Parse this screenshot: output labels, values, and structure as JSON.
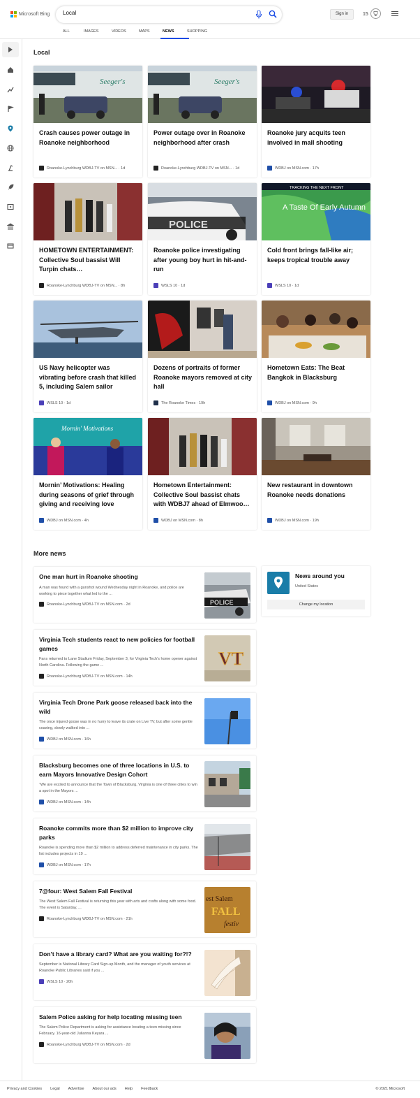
{
  "header": {
    "logo_text": "Microsoft Bing",
    "search_value": "Local",
    "signin_label": "Sign in",
    "points": "15",
    "tabs": [
      "ALL",
      "IMAGES",
      "VIDEOS",
      "MAPS",
      "NEWS",
      "SHOPPING"
    ],
    "active_tab": "NEWS"
  },
  "local": {
    "title": "Local",
    "cards": [
      {
        "title": "Crash causes power outage in Roanoke neighborhood",
        "source": "Roanoke-Lynchburg WDBJ-TV on MSN...",
        "age": "1d"
      },
      {
        "title": "Power outage over in Roanoke neighborhood after crash",
        "source": "Roanoke-Lynchburg WDBJ-TV on MSN...",
        "age": "1d"
      },
      {
        "title": "Roanoke jury acquits teen involved in mall shooting",
        "source": "WDBJ on MSN.com",
        "age": "17h"
      },
      {
        "title": "HOMETOWN ENTERTAINMENT: Collective Soul bassist Will Turpin chats…",
        "source": "Roanoke-Lynchburg WDBJ-TV on MSN...",
        "age": "8h"
      },
      {
        "title": "Roanoke police investigating after young boy hurt in hit-and-run",
        "source": "WSLS 10",
        "age": "1d"
      },
      {
        "title": "Cold front brings fall-like air; keeps tropical trouble away",
        "source": "WSLS 10",
        "age": "1d"
      },
      {
        "title": "US Navy helicopter was vibrating before crash that killed 5, including Salem sailor",
        "source": "WSLS 10",
        "age": "1d"
      },
      {
        "title": "Dozens of portraits of former Roanoke mayors removed at city hall",
        "source": "The Roanoke Times",
        "age": "19h"
      },
      {
        "title": "Hometown Eats: The Beat Bangkok in Blacksburg",
        "source": "WDBJ on MSN.com",
        "age": "9h"
      },
      {
        "title": "Mornin’ Motivations: Healing during seasons of grief through giving and receiving love",
        "source": "WDBJ on MSN.com",
        "age": "4h"
      },
      {
        "title": "Hometown Entertainment: Collective Soul bassist chats with WDBJ7 ahead of Elmwoo…",
        "source": "WDBJ on MSN.com",
        "age": "8h"
      },
      {
        "title": "New restaurant in downtown Roanoke needs donations",
        "source": "WDBJ on MSN.com",
        "age": "19h"
      }
    ],
    "image_texts": {
      "sign": "Seeger's",
      "police": "POLICE",
      "weather_banner": "TRACKING THE NEXT FRONT",
      "weather_text": "A Taste Of Early Autumn",
      "morning_logo": "Mornin' Motivations"
    }
  },
  "more": {
    "title": "More news",
    "items": [
      {
        "title": "One man hurt in Roanoke shooting",
        "snippet": "A man was found with a gunshot wound Wednesday night in Roanoke, and police are working to piece together what led to the ...",
        "source": "Roanoke-Lynchburg WDBJ-TV on MSN.com",
        "age": "2d"
      },
      {
        "title": "Virginia Tech students react to new policies for football games",
        "snippet": "Fans returned to Lane Stadium Friday, September 3, for Virginia Tech’s home opener against North Carolina. Following the game ...",
        "source": "Roanoke-Lynchburg WDBJ-TV on MSN.com",
        "age": "14h"
      },
      {
        "title": "Virginia Tech Drone Park goose released back into the wild",
        "snippet": "The once injured goose was in no hurry to leave its crate on Live TV, but after some gentle coaxing, slowly walked into ...",
        "source": "WDBJ on MSN.com",
        "age": "16h"
      },
      {
        "title": "Blacksburg becomes one of three locations in U.S. to earn Mayors Innovative Design Cohort",
        "snippet": "“We are excited to announce that the Town of Blacksburg, Virginia is one of three cities to win a spot in the Mayors ...",
        "source": "WDBJ on MSN.com",
        "age": "14h"
      },
      {
        "title": "Roanoke commits more than $2 million to improve city parks",
        "snippet": "Roanoke is spending more than $2 million to address deferred maintenance in city parks. The list includes projects in 19 ...",
        "source": "WDBJ on MSN.com",
        "age": "17h"
      },
      {
        "title": "7@four: West Salem Fall Festival",
        "snippet": "The West Salem Fall Festival is returning this year with arts and crafts along with some food. The event is Saturday, ...",
        "source": "Roanoke-Lynchburg WDBJ-TV on MSN.com",
        "age": "21h"
      },
      {
        "title": "Don’t have a library card? What are you waiting for?!?",
        "snippet": "September is National Library Card Sign-up Month, and the manager of youth services at Roanoke Public Libraries said if you ...",
        "source": "WSLS 10",
        "age": "20h"
      },
      {
        "title": "Salem Police asking for help locating missing teen",
        "snippet": "The Salem Police Department is asking for assistance locating a teen missing since February. 16-year-old Julianna Keyara ...",
        "source": "Roanoke-Lynchburg WDBJ-TV on MSN.com",
        "age": "2d"
      }
    ],
    "thumb_texts": {
      "police": "POLICE",
      "vt": "VT",
      "salem_line1": "est Salem",
      "salem_line2": "FALL",
      "salem_line3": "festiv"
    }
  },
  "around": {
    "title": "News around you",
    "location": "United States",
    "button": "Change my location"
  },
  "footer": {
    "links": [
      "Privacy and Cookies",
      "Legal",
      "Advertise",
      "About our ads",
      "Help",
      "Feedback"
    ],
    "copyright": "© 2021 Microsoft"
  },
  "colors": {
    "accent": "#174ae4",
    "pin": "#1a7da8",
    "logo_red": "#f25022",
    "logo_green": "#7fba00",
    "logo_blue": "#00a4ef",
    "logo_yellow": "#ffb900"
  }
}
